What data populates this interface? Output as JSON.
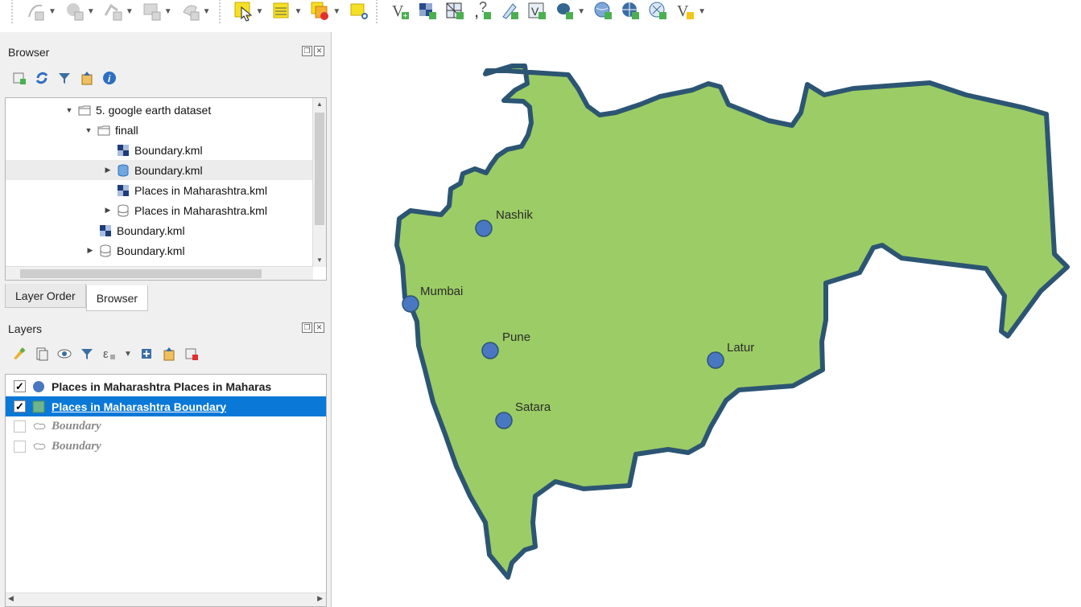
{
  "toolbar": {
    "icons": [
      "add-feature-icon",
      "digitize-icon",
      "move-feature-icon",
      "node-tool-icon",
      "vertex-icon",
      "select-icon",
      "attribute-table-icon",
      "deselect-icon",
      "identify-icon",
      "add-vector-icon",
      "add-raster-icon",
      "add-mesh-icon",
      "add-delimited-icon",
      "add-spatialite-icon",
      "add-virtual-icon",
      "add-postgis-icon",
      "add-wms-icon",
      "add-wfs-icon",
      "add-wcs-icon",
      "new-layer-icon"
    ]
  },
  "browser_panel": {
    "title": "Browser",
    "tree": [
      {
        "label": "5. google earth dataset",
        "kind": "folder",
        "expanded": true
      },
      {
        "label": "finall",
        "kind": "folder",
        "expanded": true
      },
      {
        "label": "Boundary.kml",
        "kind": "raster"
      },
      {
        "label": "Boundary.kml",
        "kind": "db",
        "selected": true
      },
      {
        "label": "Places in Maharashtra.kml",
        "kind": "raster"
      },
      {
        "label": "Places in Maharashtra.kml",
        "kind": "db-outline"
      },
      {
        "label": "Boundary.kml",
        "kind": "raster"
      },
      {
        "label": "Boundary.kml",
        "kind": "db-outline"
      }
    ]
  },
  "tabs": [
    {
      "label": "Layer Order",
      "active": false
    },
    {
      "label": "Browser",
      "active": true
    }
  ],
  "layers_panel": {
    "title": "Layers",
    "layers": [
      {
        "label": "Places in Maharashtra Places in Maharas",
        "checked": true,
        "symbol": "point",
        "symbol_color": "#4a77c2"
      },
      {
        "label": "Places in Maharashtra Boundary",
        "checked": true,
        "symbol": "polygon",
        "symbol_color": "#6db58a",
        "selected": true
      },
      {
        "label": "Boundary",
        "checked": false,
        "symbol": "feature",
        "style": "inactive"
      },
      {
        "label": "Boundary",
        "checked": false,
        "symbol": "feature",
        "style": "inactive"
      }
    ]
  },
  "map": {
    "fill_color": "#9ccc65",
    "stroke_color": "#2c5573",
    "point_color": "#4a77c2",
    "places": [
      "Nashik",
      "Mumbai",
      "Pune",
      "Latur",
      "Satara"
    ]
  }
}
